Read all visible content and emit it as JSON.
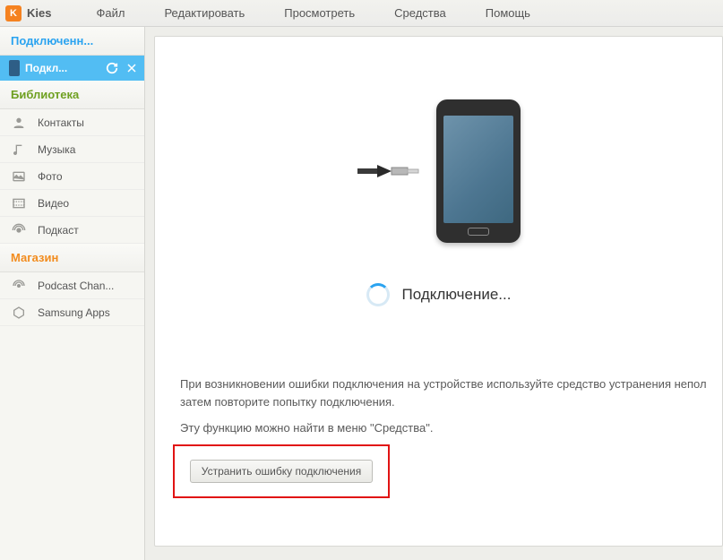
{
  "app": {
    "logo": "K",
    "title": "Kies"
  },
  "menu": {
    "file": "Файл",
    "edit": "Редактировать",
    "view": "Просмотреть",
    "tools": "Средства",
    "help": "Помощь"
  },
  "sidebar": {
    "connected_header": "Подключенн...",
    "device": {
      "label": "Подкл..."
    },
    "library_header": "Библиотека",
    "library": {
      "contacts": "Контакты",
      "music": "Музыка",
      "photo": "Фото",
      "video": "Видео",
      "podcast": "Подкаст"
    },
    "store_header": "Магазин",
    "store": {
      "podcast_channel": "Podcast Chan...",
      "samsung_apps": "Samsung Apps"
    }
  },
  "main": {
    "status": "Подключение...",
    "help_line1": "При возникновении ошибки подключения на устройстве используйте средство устранения непол",
    "help_line2": "затем повторите попытку подключения.",
    "help_line3": "Эту функцию можно найти в меню \"Средства\".",
    "fix_button": "Устранить ошибку подключения"
  }
}
